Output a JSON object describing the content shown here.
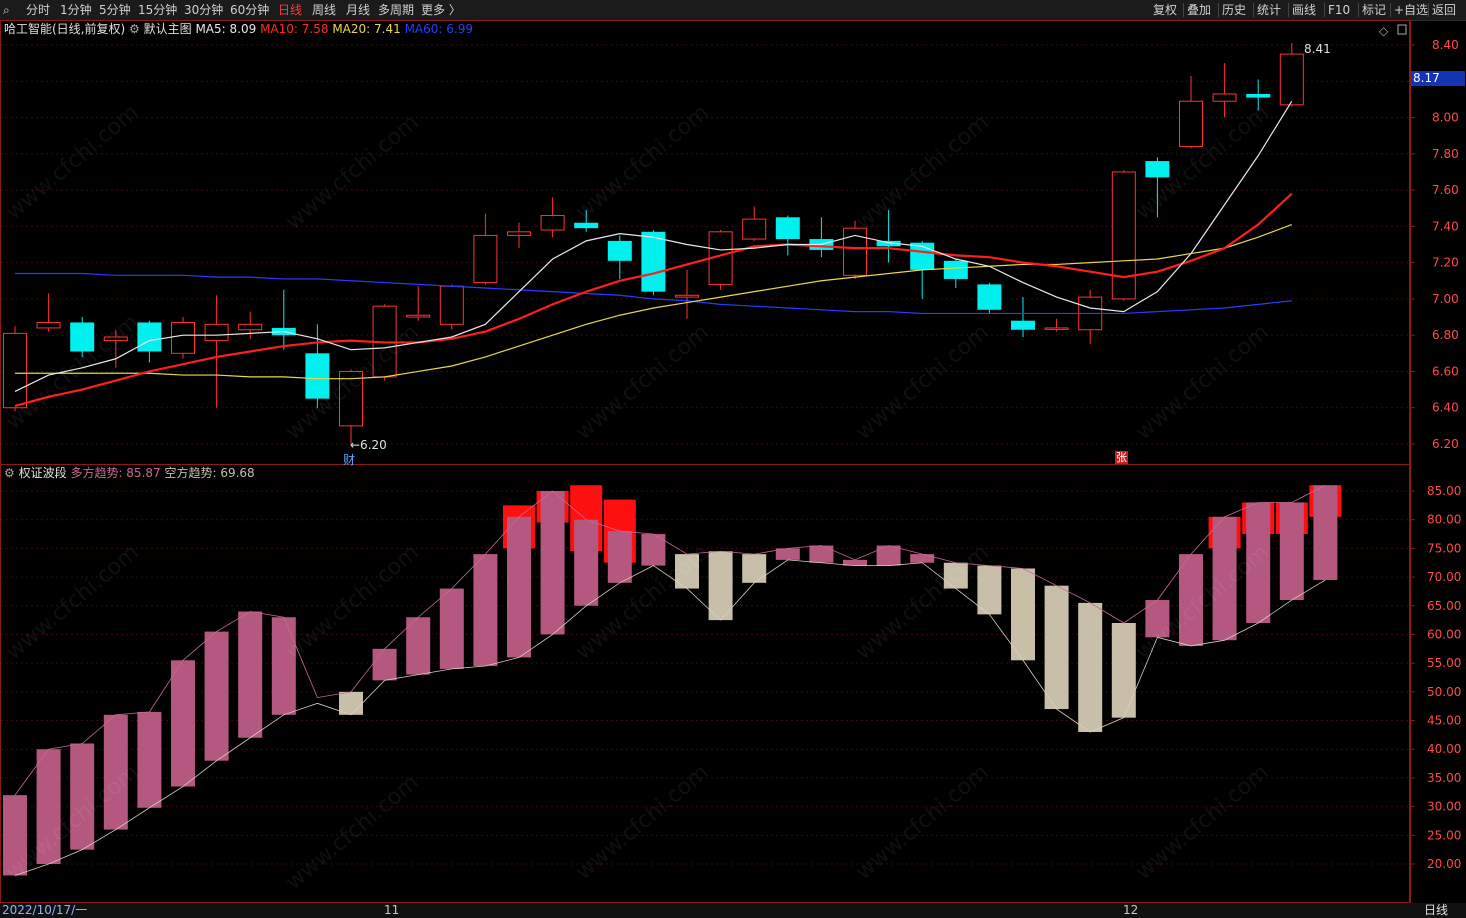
{
  "toolbar": {
    "tabs": [
      "分时",
      "1分钟",
      "5分钟",
      "15分钟",
      "30分钟",
      "60分钟",
      "日线",
      "周线",
      "月线",
      "多周期",
      "更多 〉"
    ],
    "active_tab": "日线",
    "right_buttons": [
      "复权",
      "叠加",
      "历史",
      "统计",
      "画线",
      "F10",
      "标记",
      "+自选",
      "返回"
    ]
  },
  "main_panel": {
    "stock": "哈工智能(日线,前复权)",
    "template": "默认主图",
    "ma": [
      {
        "label": "MA5: 8.09",
        "color": "#e8e8e8"
      },
      {
        "label": "MA10: 7.58",
        "color": "#ff2a2a"
      },
      {
        "label": "MA20: 7.41",
        "color": "#e8d84a"
      },
      {
        "label": "MA60: 6.99",
        "color": "#2a3cff"
      }
    ],
    "current_price": "8.17",
    "high_mark": "8.41",
    "low_mark": "←6.20",
    "marker_cai": "财",
    "marker_zhang": "张",
    "y_labels": [
      "8.40",
      "8.20",
      "8.00",
      "7.80",
      "7.60",
      "7.40",
      "7.20",
      "7.00",
      "6.80",
      "6.60",
      "6.40",
      "6.20"
    ],
    "y_values": [
      8.4,
      8.2,
      8.0,
      7.8,
      7.6,
      7.4,
      7.2,
      7.0,
      6.8,
      6.6,
      6.4,
      6.2
    ]
  },
  "sub_panel": {
    "title": "权证波段",
    "bull": "多方趋势: 85.87",
    "bear": "空方趋势: 69.68",
    "y_labels": [
      "85.00",
      "80.00",
      "75.00",
      "70.00",
      "65.00",
      "60.00",
      "55.00",
      "50.00",
      "45.00",
      "40.00",
      "35.00",
      "30.00",
      "25.00",
      "20.00"
    ],
    "y_values": [
      85,
      80,
      75,
      70,
      65,
      60,
      55,
      50,
      45,
      40,
      35,
      30,
      25,
      20
    ]
  },
  "x_axis": {
    "start": "2022/10/17/一",
    "m11": "11",
    "m12": "12",
    "period": "日线"
  },
  "colors": {
    "up": "#ff3232",
    "down": "#00f0f0",
    "ma5": "#e8e8e8",
    "ma10": "#ff1e1e",
    "ma20": "#e8d84a",
    "ma60": "#2a3cff",
    "bull": "#b5587f",
    "bear": "#c9bfa9",
    "peak": "#ff1010"
  },
  "watermark": "www.cfchi.com",
  "chart_data": {
    "type": "candlestick",
    "candles": [
      {
        "o": 6.4,
        "c": 6.81,
        "h": 6.85,
        "l": 6.38
      },
      {
        "o": 6.84,
        "c": 6.87,
        "h": 7.03,
        "l": 6.82
      },
      {
        "o": 6.87,
        "c": 6.71,
        "h": 6.9,
        "l": 6.68
      },
      {
        "o": 6.77,
        "c": 6.79,
        "h": 6.83,
        "l": 6.62
      },
      {
        "o": 6.87,
        "c": 6.71,
        "h": 6.88,
        "l": 6.65
      },
      {
        "o": 6.7,
        "c": 6.87,
        "h": 6.9,
        "l": 6.67
      },
      {
        "o": 6.77,
        "c": 6.86,
        "h": 7.02,
        "l": 6.4
      },
      {
        "o": 6.83,
        "c": 6.86,
        "h": 6.93,
        "l": 6.78
      },
      {
        "o": 6.84,
        "c": 6.8,
        "h": 7.05,
        "l": 6.72
      },
      {
        "o": 6.7,
        "c": 6.45,
        "h": 6.86,
        "l": 6.4
      },
      {
        "o": 6.3,
        "c": 6.6,
        "h": 6.61,
        "l": 6.2
      },
      {
        "o": 6.57,
        "c": 6.96,
        "h": 6.97,
        "l": 6.55
      },
      {
        "o": 6.9,
        "c": 6.91,
        "h": 7.07,
        "l": 6.88
      },
      {
        "o": 6.86,
        "c": 7.07,
        "h": 7.08,
        "l": 6.83
      },
      {
        "o": 7.09,
        "c": 7.35,
        "h": 7.47,
        "l": 7.08
      },
      {
        "o": 7.35,
        "c": 7.37,
        "h": 7.42,
        "l": 7.28
      },
      {
        "o": 7.38,
        "c": 7.46,
        "h": 7.56,
        "l": 7.34
      },
      {
        "o": 7.42,
        "c": 7.39,
        "h": 7.49,
        "l": 7.37
      },
      {
        "o": 7.32,
        "c": 7.21,
        "h": 7.35,
        "l": 7.11
      },
      {
        "o": 7.37,
        "c": 7.04,
        "h": 7.38,
        "l": 7.02
      },
      {
        "o": 7.01,
        "c": 7.02,
        "h": 7.16,
        "l": 6.89
      },
      {
        "o": 7.08,
        "c": 7.37,
        "h": 7.38,
        "l": 7.05
      },
      {
        "o": 7.33,
        "c": 7.44,
        "h": 7.51,
        "l": 7.32
      },
      {
        "o": 7.45,
        "c": 7.33,
        "h": 7.46,
        "l": 7.24
      },
      {
        "o": 7.33,
        "c": 7.27,
        "h": 7.45,
        "l": 7.23
      },
      {
        "o": 7.13,
        "c": 7.39,
        "h": 7.43,
        "l": 7.11
      },
      {
        "o": 7.32,
        "c": 7.29,
        "h": 7.49,
        "l": 7.2
      },
      {
        "o": 7.31,
        "c": 7.16,
        "h": 7.32,
        "l": 7.0
      },
      {
        "o": 7.21,
        "c": 7.11,
        "h": 7.22,
        "l": 7.06
      },
      {
        "o": 7.08,
        "c": 6.94,
        "h": 7.09,
        "l": 6.92
      },
      {
        "o": 6.88,
        "c": 6.83,
        "h": 7.01,
        "l": 6.79
      },
      {
        "o": 6.84,
        "c": 6.84,
        "h": 6.89,
        "l": 6.82
      },
      {
        "o": 6.83,
        "c": 7.01,
        "h": 7.05,
        "l": 6.75
      },
      {
        "o": 7.0,
        "c": 7.7,
        "h": 7.71,
        "l": 6.99
      },
      {
        "o": 7.76,
        "c": 7.67,
        "h": 7.78,
        "l": 7.45
      },
      {
        "o": 7.84,
        "c": 8.09,
        "h": 8.23,
        "l": 7.83
      },
      {
        "o": 8.09,
        "c": 8.13,
        "h": 8.3,
        "l": 8.0
      },
      {
        "o": 8.13,
        "c": 8.11,
        "h": 8.21,
        "l": 8.04
      },
      {
        "o": 8.07,
        "c": 8.35,
        "h": 8.41,
        "l": 8.06
      }
    ],
    "ma5": [
      6.49,
      6.58,
      6.62,
      6.67,
      6.77,
      6.8,
      6.8,
      6.81,
      6.82,
      6.78,
      6.72,
      6.73,
      6.76,
      6.79,
      6.86,
      7.04,
      7.22,
      7.32,
      7.36,
      7.34,
      7.3,
      7.27,
      7.28,
      7.3,
      7.3,
      7.35,
      7.31,
      7.29,
      7.22,
      7.18,
      7.09,
      7.01,
      6.95,
      6.93,
      7.04,
      7.25,
      7.52,
      7.79,
      8.09
    ],
    "ma10": [
      6.41,
      6.46,
      6.5,
      6.55,
      6.6,
      6.64,
      6.68,
      6.71,
      6.74,
      6.76,
      6.77,
      6.76,
      6.76,
      6.78,
      6.82,
      6.89,
      6.97,
      7.04,
      7.1,
      7.14,
      7.19,
      7.24,
      7.29,
      7.3,
      7.29,
      7.28,
      7.28,
      7.26,
      7.24,
      7.23,
      7.2,
      7.18,
      7.15,
      7.12,
      7.15,
      7.21,
      7.28,
      7.41,
      7.58
    ],
    "ma20": [
      6.59,
      6.59,
      6.59,
      6.59,
      6.59,
      6.58,
      6.58,
      6.57,
      6.57,
      6.56,
      6.56,
      6.57,
      6.6,
      6.63,
      6.68,
      6.74,
      6.8,
      6.86,
      6.91,
      6.95,
      6.98,
      7.01,
      7.04,
      7.07,
      7.1,
      7.12,
      7.14,
      7.16,
      7.17,
      7.18,
      7.19,
      7.19,
      7.2,
      7.21,
      7.22,
      7.25,
      7.28,
      7.34,
      7.41
    ],
    "ma60": [
      7.14,
      7.14,
      7.14,
      7.13,
      7.13,
      7.13,
      7.12,
      7.12,
      7.11,
      7.11,
      7.1,
      7.09,
      7.08,
      7.07,
      7.06,
      7.05,
      7.04,
      7.03,
      7.02,
      7.0,
      6.99,
      6.97,
      6.96,
      6.95,
      6.94,
      6.93,
      6.93,
      6.92,
      6.92,
      6.92,
      6.92,
      6.92,
      6.92,
      6.92,
      6.93,
      6.94,
      6.95,
      6.97,
      6.99
    ],
    "bands": [
      {
        "top": 32.0,
        "bot": 18.0,
        "type": "bull"
      },
      {
        "top": 40.0,
        "bot": 20.0,
        "type": "bull"
      },
      {
        "top": 41.0,
        "bot": 22.5,
        "type": "bull"
      },
      {
        "top": 46.0,
        "bot": 26.0,
        "type": "bull"
      },
      {
        "top": 46.5,
        "bot": 29.8,
        "type": "bull"
      },
      {
        "top": 55.5,
        "bot": 33.5,
        "type": "bull"
      },
      {
        "top": 60.5,
        "bot": 38.0,
        "type": "bull"
      },
      {
        "top": 64.0,
        "bot": 42.0,
        "type": "bull"
      },
      {
        "top": 63.0,
        "bot": 46.0,
        "type": "bull"
      },
      {
        "top": null,
        "bot": null,
        "type": "none"
      },
      {
        "top": 50.0,
        "bot": 46.0,
        "type": "bear"
      },
      {
        "top": 57.5,
        "bot": 52.0,
        "type": "bull"
      },
      {
        "top": 63.0,
        "bot": 53.0,
        "type": "bull"
      },
      {
        "top": 68.0,
        "bot": 54.0,
        "type": "bull"
      },
      {
        "top": 74.0,
        "bot": 54.5,
        "type": "bull"
      },
      {
        "top": 80.5,
        "bot": 56.0,
        "type": "bull",
        "peak": 82.5
      },
      {
        "top": 85.0,
        "bot": 60.0,
        "type": "bull",
        "peak": 85.0
      },
      {
        "top": 80.0,
        "bot": 65.0,
        "type": "bull",
        "peak": 86.0
      },
      {
        "top": 78.0,
        "bot": 69.0,
        "type": "bull",
        "peak": 83.5
      },
      {
        "top": 77.5,
        "bot": 72.0,
        "type": "bull"
      },
      {
        "top": 74.0,
        "bot": 68.0,
        "type": "bear"
      },
      {
        "top": 74.5,
        "bot": 62.5,
        "type": "bear"
      },
      {
        "top": 74.0,
        "bot": 69.0,
        "type": "bear"
      },
      {
        "top": 75.0,
        "bot": 73.0,
        "type": "bull"
      },
      {
        "top": 75.5,
        "bot": 72.5,
        "type": "bull"
      },
      {
        "top": 73.0,
        "bot": 72.0,
        "type": "bull"
      },
      {
        "top": 75.5,
        "bot": 72.0,
        "type": "bull"
      },
      {
        "top": 74.0,
        "bot": 72.5,
        "type": "bull"
      },
      {
        "top": 72.5,
        "bot": 68.0,
        "type": "bear"
      },
      {
        "top": 72.0,
        "bot": 63.5,
        "type": "bear"
      },
      {
        "top": 71.5,
        "bot": 55.5,
        "type": "bear"
      },
      {
        "top": 68.5,
        "bot": 47.0,
        "type": "bear"
      },
      {
        "top": 65.5,
        "bot": 43.0,
        "type": "bear"
      },
      {
        "top": 62.0,
        "bot": 45.5,
        "type": "bear"
      },
      {
        "top": 66.0,
        "bot": 59.5,
        "type": "bull"
      },
      {
        "top": 74.0,
        "bot": 58.0,
        "type": "bull"
      },
      {
        "top": 80.5,
        "bot": 59.0,
        "type": "bull",
        "peak": 80.5
      },
      {
        "top": 83.0,
        "bot": 62.0,
        "type": "bull",
        "peak": 83.0
      },
      {
        "top": 83.0,
        "bot": 66.0,
        "type": "bull",
        "peak": 83.0
      },
      {
        "top": 86.0,
        "bot": 69.5,
        "type": "bull",
        "peak": 86.0
      }
    ]
  }
}
